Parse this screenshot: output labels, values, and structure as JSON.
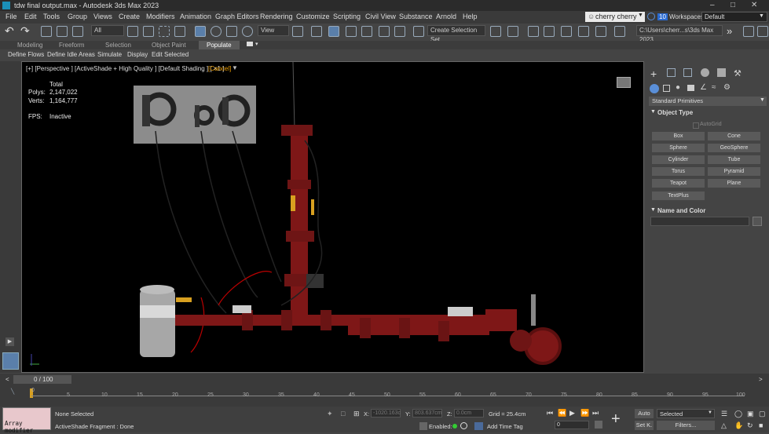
{
  "window": {
    "title": "tdw final output.max - Autodesk 3ds Max 2023"
  },
  "menu": [
    "File",
    "Edit",
    "Tools",
    "Group",
    "Views",
    "Create",
    "Modifiers",
    "Animation",
    "Graph Editors",
    "Rendering",
    "Customize",
    "Scripting",
    "Civil View",
    "Substance",
    "Arnold",
    "Help"
  ],
  "user": {
    "name": "cherry cherry",
    "notifications": "10",
    "workspaces_label": "Workspaces:",
    "workspace": "Default"
  },
  "toolbar": {
    "filter": "All",
    "view": "View",
    "selection_set": "Create Selection Set",
    "path": "C:\\Users\\cherr...s\\3ds Max 2023"
  },
  "ribbon": {
    "tabs": [
      "Modeling",
      "Freeform",
      "Selection",
      "Object Paint",
      "Populate"
    ],
    "active": "Populate",
    "subtabs": [
      "Define Flows",
      "Define Idle Areas",
      "Simulate",
      "Display",
      "Edit Selected"
    ]
  },
  "viewport": {
    "label": "[+] [Perspective ] [ActiveShade + High Quality ] [Default Shading ] [ ×1 ]",
    "cancel": "[Cancel]",
    "stats": {
      "total": "Total",
      "polys_label": "Polys:",
      "polys": "2,147,022",
      "verts_label": "Verts:",
      "verts": "1,164,777",
      "fps_label": "FPS:",
      "fps": "Inactive"
    }
  },
  "command_panel": {
    "category": "Standard Primitives",
    "object_type_title": "Object Type",
    "autogrid": "AutoGrid",
    "buttons": [
      "Box",
      "Cone",
      "Sphere",
      "GeoSphere",
      "Cylinder",
      "Tube",
      "Torus",
      "Pyramid",
      "Teapot",
      "Plane",
      "TextPlus"
    ],
    "name_color_title": "Name and Color"
  },
  "timeline": {
    "frame": "0 / 100",
    "ticks": [
      "0",
      "5",
      "10",
      "15",
      "20",
      "25",
      "30",
      "35",
      "40",
      "45",
      "50",
      "55",
      "60",
      "65",
      "70",
      "75",
      "80",
      "85",
      "90",
      "95",
      "100"
    ]
  },
  "status": {
    "script": "Array modifier",
    "selection": "None Selected",
    "message": "ActiveShade Fragment : Done",
    "x_label": "X:",
    "x": "-1020.163c",
    "y_label": "Y:",
    "y": "803.637cm",
    "z_label": "Z:",
    "z": "0.0cm",
    "grid": "Grid = 25.4cm",
    "enabled": "Enabled:",
    "add_time_tag": "Add Time Tag",
    "auto": "Auto",
    "set_key": "Set K.",
    "selected": "Selected",
    "filters": "Filters...",
    "frame_field": "0"
  },
  "colors": {
    "pipe": "#8b1a1a",
    "viewport_bg": "#000000",
    "accent": "#5a8fd8"
  }
}
